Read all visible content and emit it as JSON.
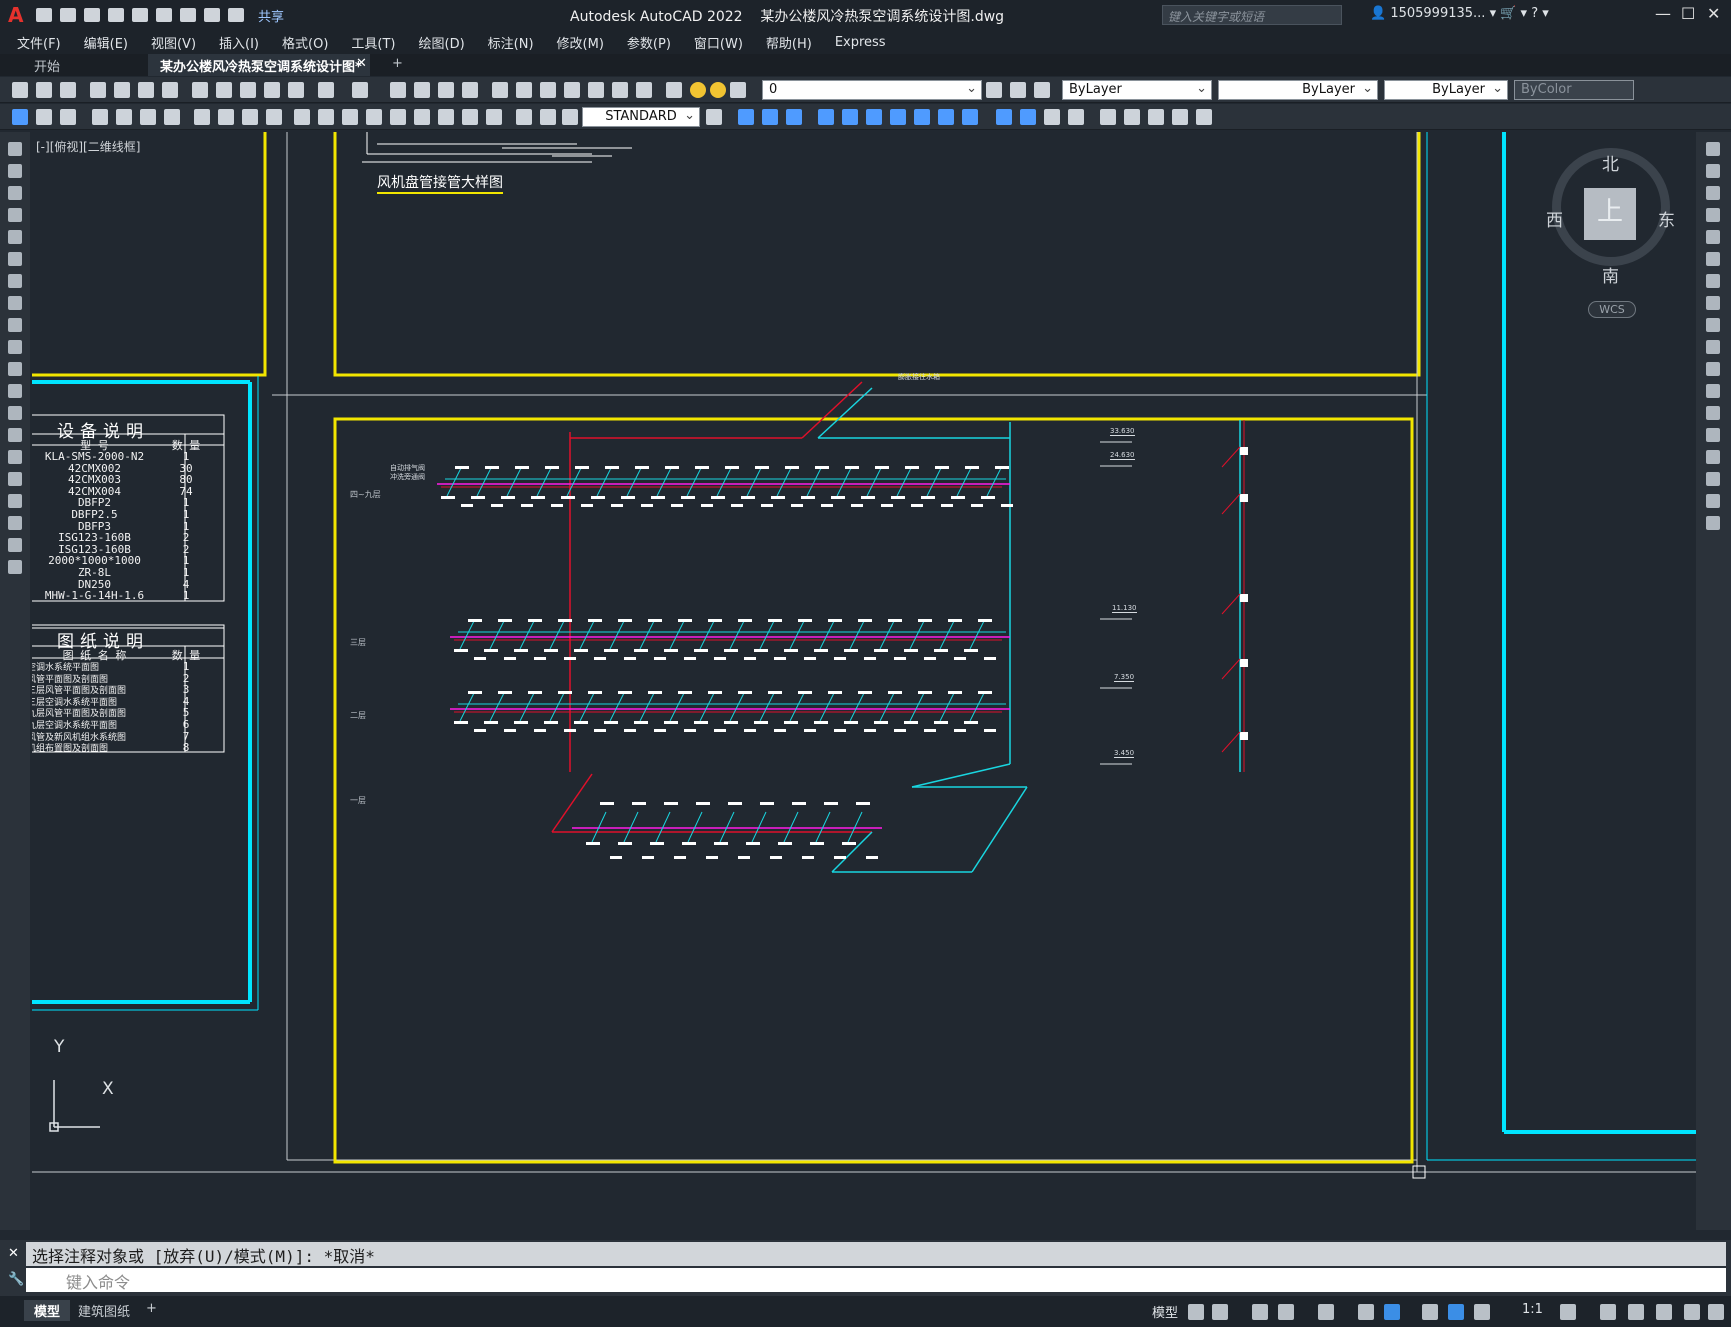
{
  "window": {
    "app_title": "Autodesk AutoCAD 2022",
    "file_name": "某办公楼风冷热泵空调系统设计图.dwg",
    "share_label": "共享",
    "search_placeholder": "键入关键字或短语",
    "user_name": "1505999135...",
    "minimize": "—",
    "maximize": "☐",
    "close": "✕"
  },
  "menu": [
    "文件(F)",
    "编辑(E)",
    "视图(V)",
    "插入(I)",
    "格式(O)",
    "工具(T)",
    "绘图(D)",
    "标注(N)",
    "修改(M)",
    "参数(P)",
    "窗口(W)",
    "帮助(H)",
    "Express"
  ],
  "tabs": {
    "start": "开始",
    "active": "某办公楼风冷热泵空调系统设计图*",
    "close": "✕",
    "add": "+"
  },
  "toolbar": {
    "layer_value": "0",
    "color_value": "ByLayer",
    "linetype_value": "ByLayer",
    "lineweight_value": "ByLayer",
    "plotstyle_value": "ByColor",
    "textstyle_value": "STANDARD"
  },
  "canvas": {
    "view_label": "[-][俯视][二维线框]",
    "detail_caption": "风机盘管接管大样图",
    "equipment_table": {
      "title": "设备说明",
      "header": [
        "型 号",
        "数 量"
      ],
      "rows": [
        [
          "KLA-SMS-2000-N2",
          "1"
        ],
        [
          "42CMX002",
          "30"
        ],
        [
          "42CMX003",
          "80"
        ],
        [
          "42CMX004",
          "74"
        ],
        [
          "DBFP2",
          "1"
        ],
        [
          "DBFP2.5",
          "1"
        ],
        [
          "DBFP3",
          "1"
        ],
        [
          "ISG123-160B",
          "2"
        ],
        [
          "ISG123-160B",
          "2"
        ],
        [
          "2000*1000*1000",
          "1"
        ],
        [
          "ZR-8L",
          "1"
        ],
        [
          "DN250",
          "4"
        ],
        [
          "MHW-1-G-14H-1.6",
          "1"
        ]
      ]
    },
    "drawing_table": {
      "title": "图纸说明",
      "header": [
        "图 纸 名 称",
        "数 量"
      ],
      "rows": [
        [
          "空调水系统平面图",
          "1"
        ],
        [
          "风管平面图及剖面图",
          "2"
        ],
        [
          "三层风管平面图及剖面图",
          "3"
        ],
        [
          "三层空调水系统平面图",
          "4"
        ],
        [
          "九层风管平面图及剖面图",
          "5"
        ],
        [
          "九层空调水系统平面图",
          "6"
        ],
        [
          "风管及新风机组水系统图",
          "7"
        ],
        [
          "机组布置图及剖面图",
          "8"
        ]
      ]
    },
    "level_labels": [
      "四~九层",
      "三层",
      "二层",
      "一层"
    ],
    "elevation_labels": [
      "33.630",
      "24.630",
      "11.130",
      "7.350",
      "3.450"
    ],
    "notes": [
      "自动排气阀",
      "冲洗旁通阀",
      "膨胀接往水箱"
    ],
    "viewcube": {
      "north": "北",
      "south": "南",
      "east": "东",
      "west": "西",
      "top": "上",
      "wcs": "WCS"
    },
    "ucs": {
      "y": "Y",
      "x": "X"
    }
  },
  "command": {
    "history": "选择注释对象或 [放弃(U)/模式(M)]: *取消*",
    "placeholder": "键入命令"
  },
  "status": {
    "model_tab": "模型",
    "layout_tab": "建筑图纸",
    "add": "+",
    "model_label": "模型",
    "scale": "1:1"
  },
  "colors": {
    "yellow_frame": "#f2e600",
    "cyan_frame": "#00e5ff",
    "pipe_red": "#e0102a",
    "pipe_cyan": "#19d6e0",
    "pipe_magenta": "#ff1ae8"
  }
}
